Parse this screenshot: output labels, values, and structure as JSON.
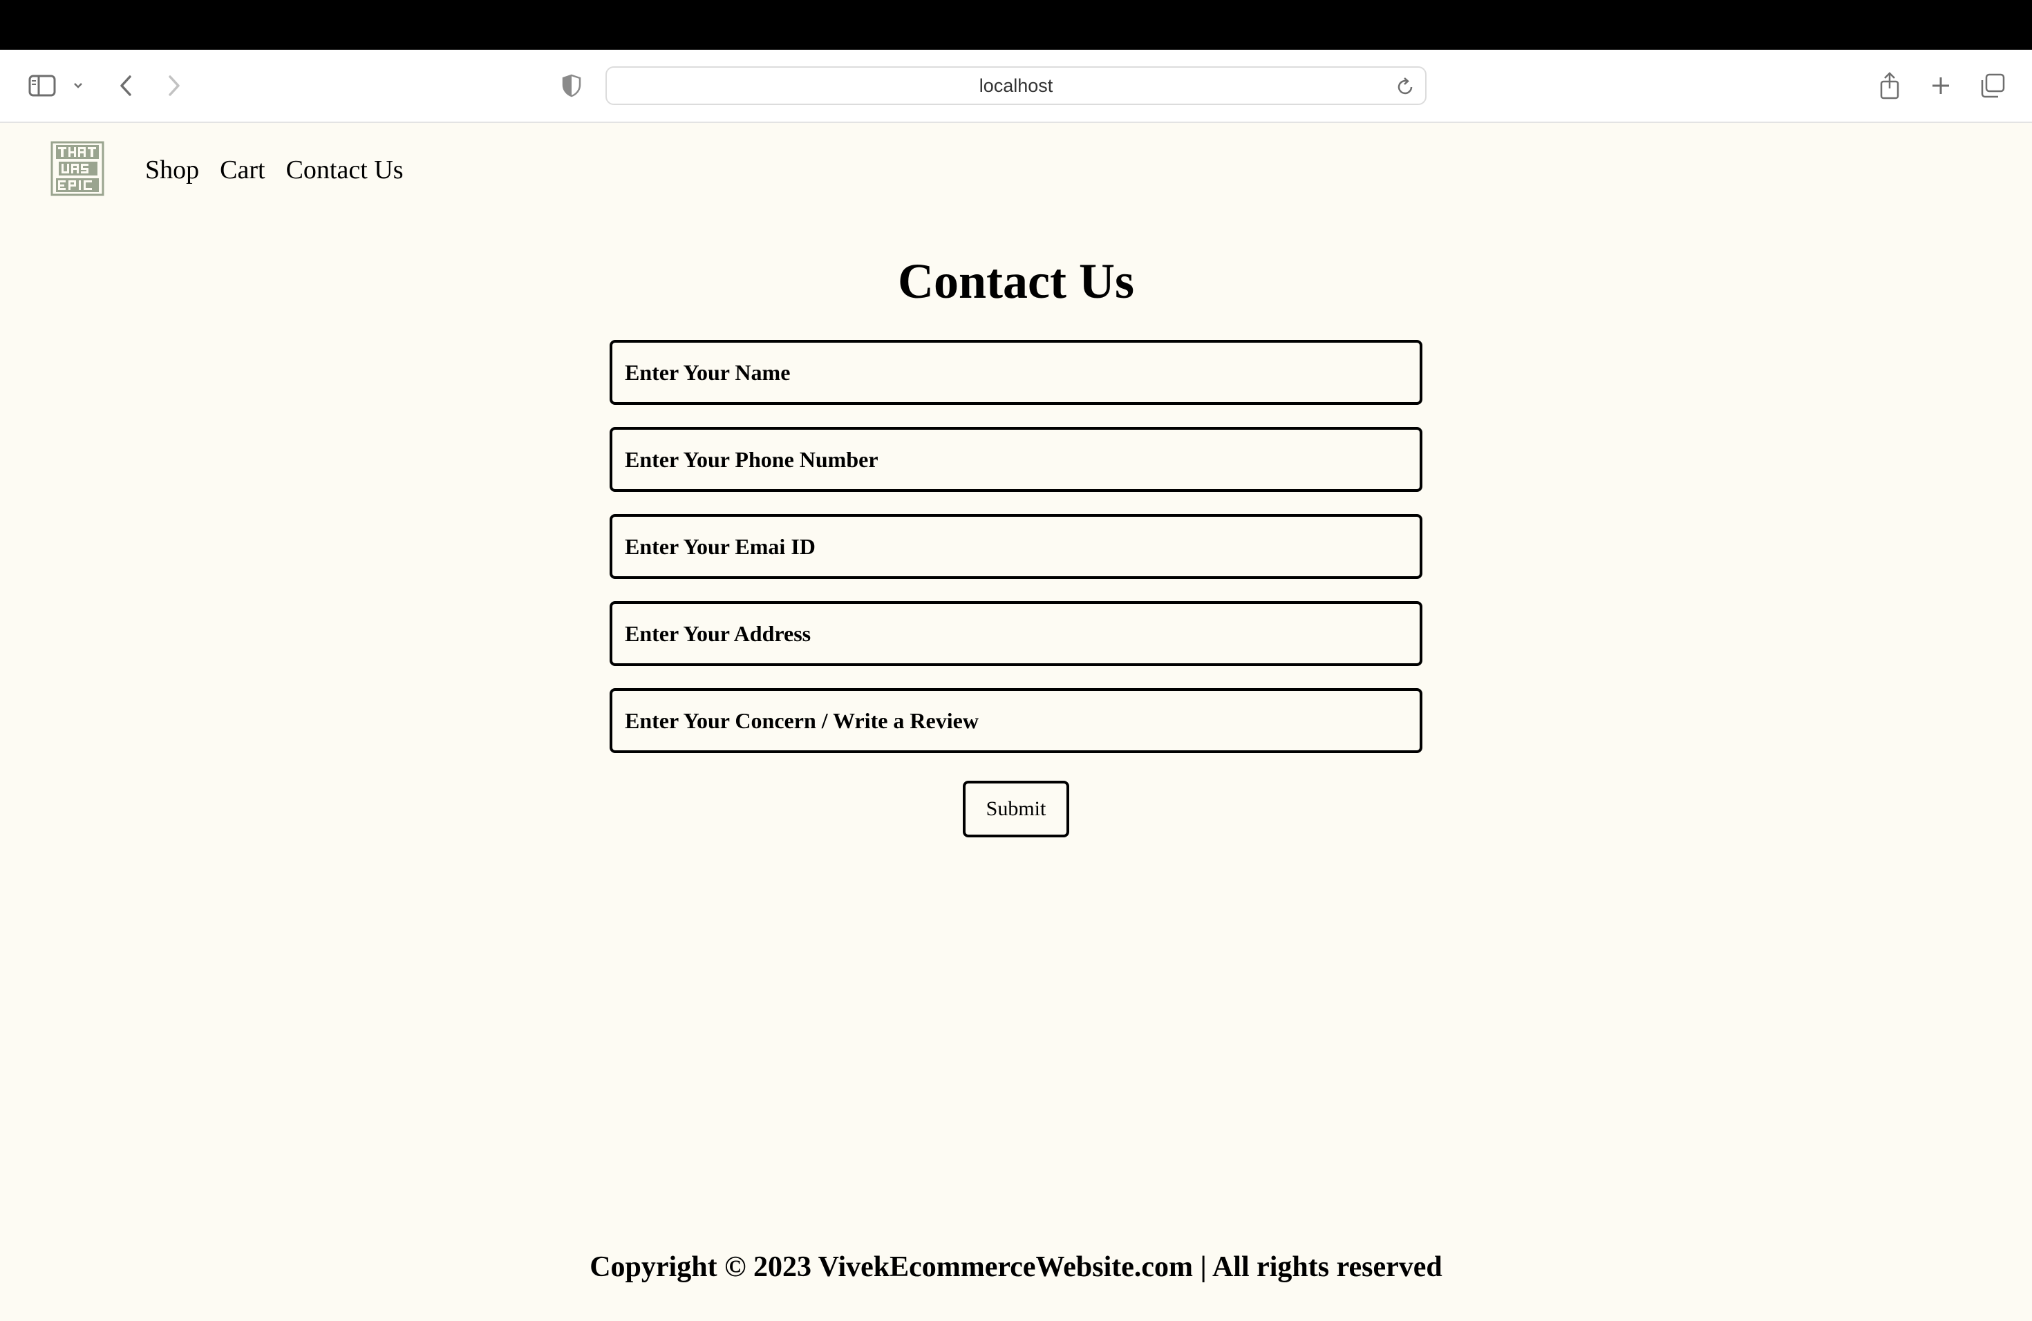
{
  "browser": {
    "url": "localhost"
  },
  "header": {
    "logo_text": "THAT WAS EPIC",
    "nav": [
      {
        "label": "Shop"
      },
      {
        "label": "Cart"
      },
      {
        "label": "Contact Us"
      }
    ]
  },
  "main": {
    "title": "Contact Us",
    "fields": [
      {
        "placeholder": "Enter Your Name",
        "value": ""
      },
      {
        "placeholder": "Enter Your Phone Number",
        "value": ""
      },
      {
        "placeholder": "Enter Your Emai ID",
        "value": ""
      },
      {
        "placeholder": "Enter Your Address",
        "value": ""
      },
      {
        "placeholder": "Enter Your Concern / Write a Review",
        "value": ""
      }
    ],
    "submit_label": "Submit"
  },
  "footer": {
    "text": "Copyright © 2023 VivekEcommerceWebsite.com | All rights reserved"
  }
}
